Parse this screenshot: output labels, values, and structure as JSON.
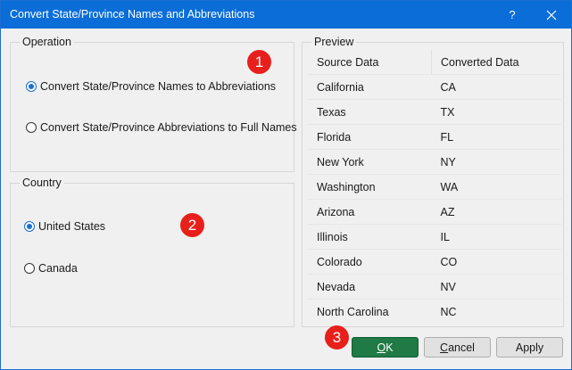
{
  "window": {
    "title": "Convert State/Province Names and Abbreviations",
    "help_label": "?",
    "close_label": "✕"
  },
  "operation": {
    "label": "Operation",
    "options": [
      {
        "label": "Convert State/Province Names to Abbreviations",
        "selected": true
      },
      {
        "label": "Convert State/Province Abbreviations to Full Names",
        "selected": false
      }
    ]
  },
  "country": {
    "label": "Country",
    "options": [
      {
        "label": "United States",
        "selected": true
      },
      {
        "label": "Canada",
        "selected": false
      }
    ]
  },
  "preview": {
    "label": "Preview",
    "columns": [
      "Source Data",
      "Converted Data"
    ],
    "rows": [
      [
        "California",
        "CA"
      ],
      [
        "Texas",
        "TX"
      ],
      [
        "Florida",
        "FL"
      ],
      [
        "New York",
        "NY"
      ],
      [
        "Washington",
        "WA"
      ],
      [
        "Arizona",
        "AZ"
      ],
      [
        "Illinois",
        "IL"
      ],
      [
        "Colorado",
        "CO"
      ],
      [
        "Nevada",
        "NV"
      ],
      [
        "North Carolina",
        "NC"
      ]
    ]
  },
  "badges": [
    "1",
    "2",
    "3"
  ],
  "buttons": {
    "ok": "OK",
    "cancel": "Cancel",
    "apply": "Apply"
  },
  "colors": {
    "titlebar": "#0a6dd8",
    "badge": "#e8201c",
    "ok_button": "#1f7a45",
    "radio_selected": "#1a6ed0"
  },
  "icons": {
    "help": "help-icon",
    "close": "close-icon"
  }
}
